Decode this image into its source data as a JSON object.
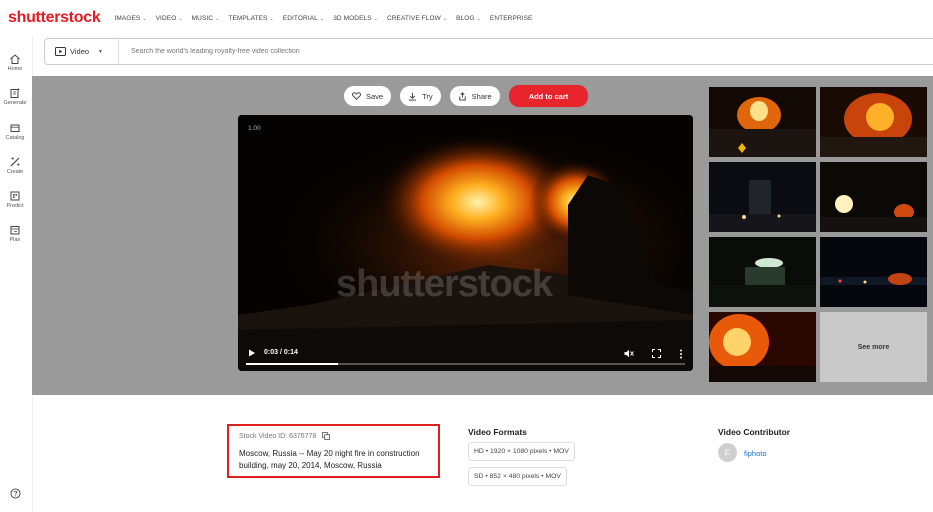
{
  "brand": {
    "logo_text": "shutterstock",
    "accent": "#e81c24"
  },
  "nav": {
    "items": [
      {
        "label": "IMAGES",
        "chevron": true
      },
      {
        "label": "VIDEO",
        "chevron": true
      },
      {
        "label": "MUSIC",
        "chevron": true
      },
      {
        "label": "TEMPLATES",
        "chevron": true
      },
      {
        "label": "EDITORIAL",
        "chevron": true
      },
      {
        "label": "3D MODELS",
        "chevron": true
      },
      {
        "label": "CREATIVE FLOW",
        "chevron": true
      },
      {
        "label": "BLOG",
        "chevron": true
      },
      {
        "label": "ENTERPRISE",
        "chevron": false
      }
    ]
  },
  "sidebar": {
    "items": [
      {
        "label": "Home",
        "icon": "home-icon"
      },
      {
        "label": "Generate",
        "icon": "generate-icon"
      },
      {
        "label": "Catalog",
        "icon": "catalog-icon"
      },
      {
        "label": "Create",
        "icon": "create-icon"
      },
      {
        "label": "Predict",
        "icon": "predict-icon"
      },
      {
        "label": "Plan",
        "icon": "plan-icon"
      }
    ],
    "help_icon": "help-icon"
  },
  "search": {
    "media_type": "Video",
    "placeholder": "Search the world's leading royalty-free video collection"
  },
  "actions": {
    "save": "Save",
    "try": "Try",
    "share": "Share",
    "add_to_cart": "Add to cart"
  },
  "player": {
    "overlay_time": "1.00",
    "watermark": "shutterstock",
    "time": "0:03 / 0:14",
    "progress": 0.21
  },
  "related": {
    "see_more": "See more"
  },
  "details": {
    "stock_id": "Stock Video ID: 6376778",
    "description": "Moscow, Russia -- May 20 night fire in construction building, may 20, 2014, Moscow, Russia"
  },
  "formats": {
    "title": "Video Formats",
    "items": [
      "HD • 1920 × 1080 pixels • MOV",
      "SD • 852 × 480 pixels • MOV"
    ]
  },
  "contributor": {
    "title": "Video Contributor",
    "initial": "F",
    "name": "fiphoto"
  }
}
